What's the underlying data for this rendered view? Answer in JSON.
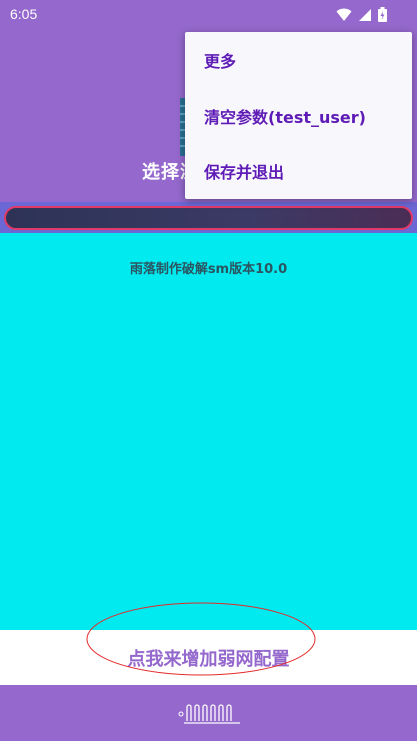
{
  "status_bar": {
    "time": "6:05"
  },
  "header": {
    "title": "选择浏览器设置"
  },
  "content": {
    "text": "雨落制作破解sm版本10.0"
  },
  "add_config": {
    "label": "点我来增加弱网配置"
  },
  "menu": {
    "items": [
      {
        "label": "更多"
      },
      {
        "label": "清空参数(test_user)"
      },
      {
        "label": "保存并退出"
      }
    ]
  },
  "colors": {
    "primary": "#9468cc",
    "content_bg": "#00eaf0",
    "menu_text": "#5e1bb5",
    "accent_red": "#e23a68"
  },
  "icons": [
    "wifi-icon",
    "signal-icon",
    "battery-icon",
    "app-logo-icon",
    "terminal-icon"
  ]
}
